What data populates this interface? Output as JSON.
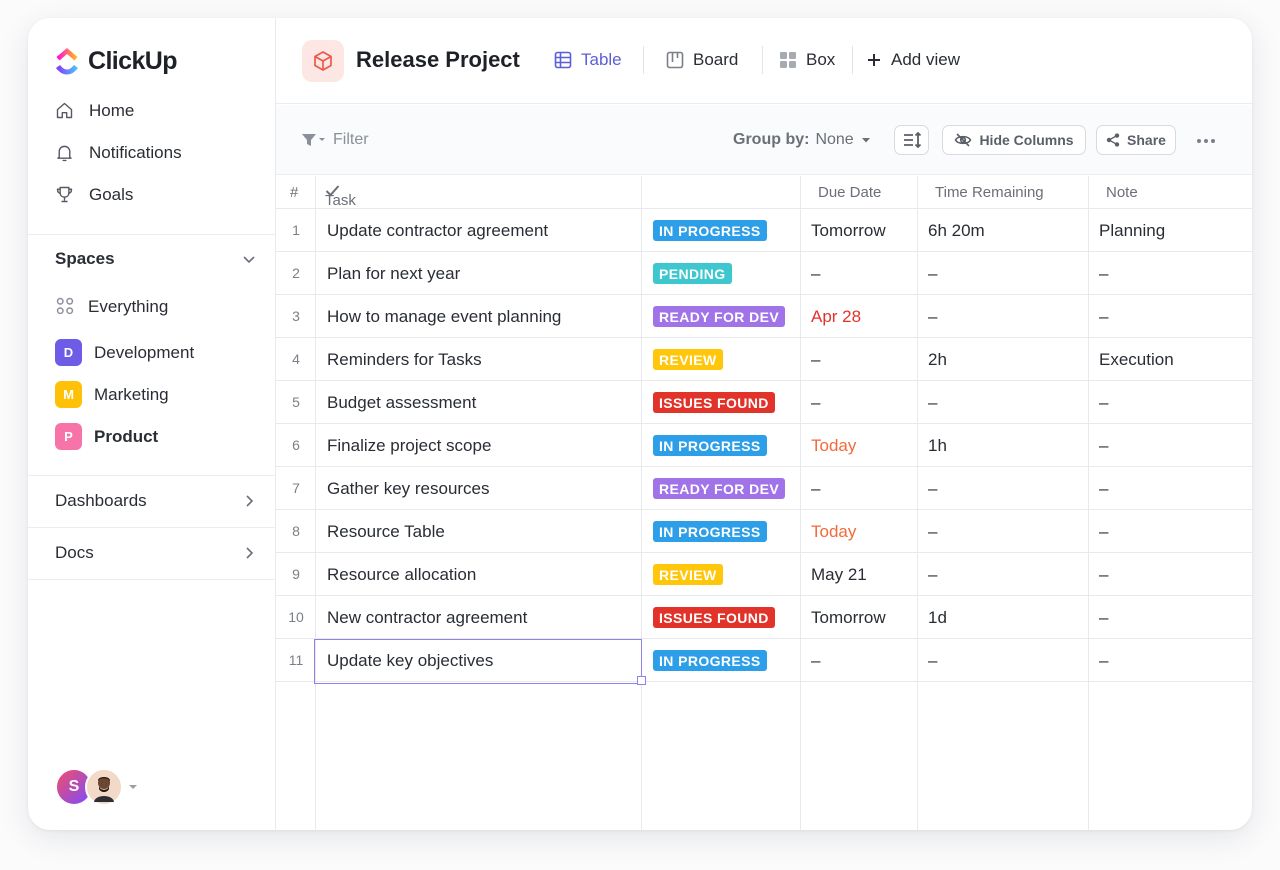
{
  "app": {
    "logo_text": "ClickUp"
  },
  "sidebar": {
    "nav": [
      {
        "label": "Home",
        "icon": "home-icon"
      },
      {
        "label": "Notifications",
        "icon": "bell-icon"
      },
      {
        "label": "Goals",
        "icon": "trophy-icon"
      }
    ],
    "spaces_label": "Spaces",
    "spaces": [
      {
        "label": "Everything",
        "icon": "grid-icon"
      },
      {
        "label": "Development",
        "badge": "D",
        "color": "#6f5ce6"
      },
      {
        "label": "Marketing",
        "badge": "M",
        "color": "#ffc107"
      },
      {
        "label": "Product",
        "badge": "P",
        "color": "#f774a8"
      }
    ],
    "dashboards_label": "Dashboards",
    "docs_label": "Docs",
    "avatar_initial": "S"
  },
  "header": {
    "title": "Release Project",
    "views": [
      {
        "label": "Table",
        "active": true
      },
      {
        "label": "Board"
      },
      {
        "label": "Box"
      },
      {
        "label": "Add view"
      }
    ]
  },
  "toolbar": {
    "filter_label": "Filter",
    "group_by_label": "Group by:",
    "group_by_value": "None",
    "hide_columns_label": "Hide Columns",
    "share_label": "Share"
  },
  "table": {
    "columns": {
      "num": "#",
      "task": "Task",
      "status": "",
      "due": "Due Date",
      "remaining": "Time Remaining",
      "note": "Note"
    },
    "rows": [
      {
        "num": "1",
        "task": "Update contractor agreement",
        "status": "IN PROGRESS",
        "due": "Tomorrow",
        "remaining": "6h 20m",
        "note": "Planning"
      },
      {
        "num": "2",
        "task": "Plan for next year",
        "status": "PENDING",
        "due": "–",
        "remaining": "–",
        "note": "–"
      },
      {
        "num": "3",
        "task": "How to manage event planning",
        "status": "READY FOR DEV",
        "due": "Apr 28",
        "remaining": "–",
        "note": "–"
      },
      {
        "num": "4",
        "task": "Reminders for Tasks",
        "status": "REVIEW",
        "due": "–",
        "remaining": "2h",
        "note": "Execution"
      },
      {
        "num": "5",
        "task": "Budget assessment",
        "status": "ISSUES FOUND",
        "due": "–",
        "remaining": "–",
        "note": "–"
      },
      {
        "num": "6",
        "task": "Finalize project scope",
        "status": "IN PROGRESS",
        "due": "Today",
        "remaining": "1h",
        "note": "–"
      },
      {
        "num": "7",
        "task": "Gather key resources",
        "status": "READY FOR DEV",
        "due": "–",
        "remaining": "–",
        "note": "–"
      },
      {
        "num": "8",
        "task": "Resource Table",
        "status": "IN PROGRESS",
        "due": "Today",
        "remaining": "–",
        "note": "–"
      },
      {
        "num": "9",
        "task": "Resource allocation",
        "status": "REVIEW",
        "due": "May 21",
        "remaining": "–",
        "note": "–"
      },
      {
        "num": "10",
        "task": "New contractor agreement",
        "status": "ISSUES FOUND",
        "due": "Tomorrow",
        "remaining": "1d",
        "note": "–"
      },
      {
        "num": "11",
        "task": "Update key objectives",
        "status": "IN PROGRESS",
        "due": "–",
        "remaining": "–",
        "note": "–"
      }
    ]
  },
  "status_colors": {
    "IN PROGRESS": "#2d9ee8",
    "PENDING": "#3ec7cf",
    "READY FOR DEV": "#a173e8",
    "REVIEW": "#ffc60a",
    "ISSUES FOUND": "#e2332b"
  },
  "due_colors": {
    "Apr 28": "#e2332b",
    "Today": "#f26b3a"
  }
}
